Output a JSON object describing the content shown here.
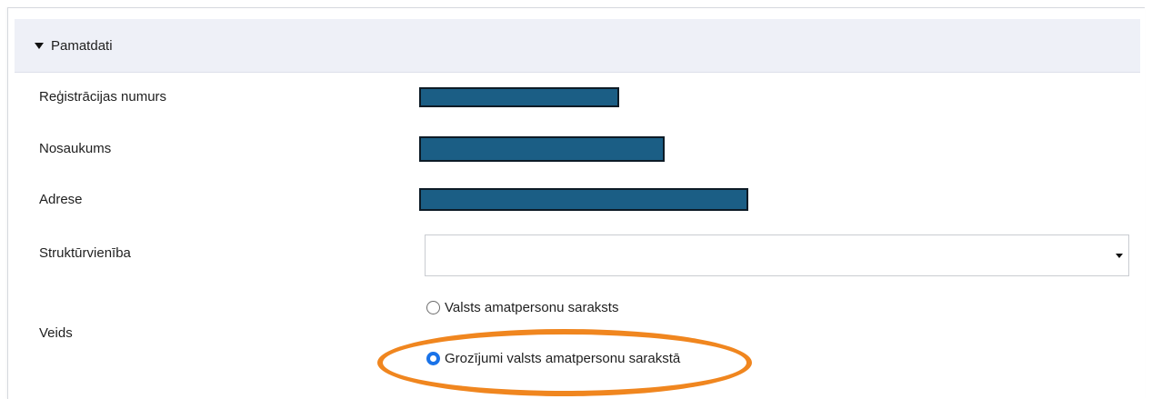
{
  "section": {
    "title": "Pamatdati",
    "expanded": true
  },
  "fields": {
    "registration_number": {
      "label": "Reģistrācijas numurs"
    },
    "name": {
      "label": "Nosaukums"
    },
    "address": {
      "label": "Adrese"
    },
    "unit": {
      "label": "Struktūrvienība",
      "value": ""
    },
    "type": {
      "label": "Veids",
      "options": [
        {
          "label": "Valsts amatpersonu saraksts",
          "selected": false
        },
        {
          "label": "Grozījumi valsts amatpersonu sarakstā",
          "selected": true
        }
      ]
    }
  },
  "colors": {
    "redaction": "#1b5e85",
    "highlight": "#f0861f",
    "header_bg": "#eef0f7",
    "radio_accent": "#1a73e8"
  }
}
